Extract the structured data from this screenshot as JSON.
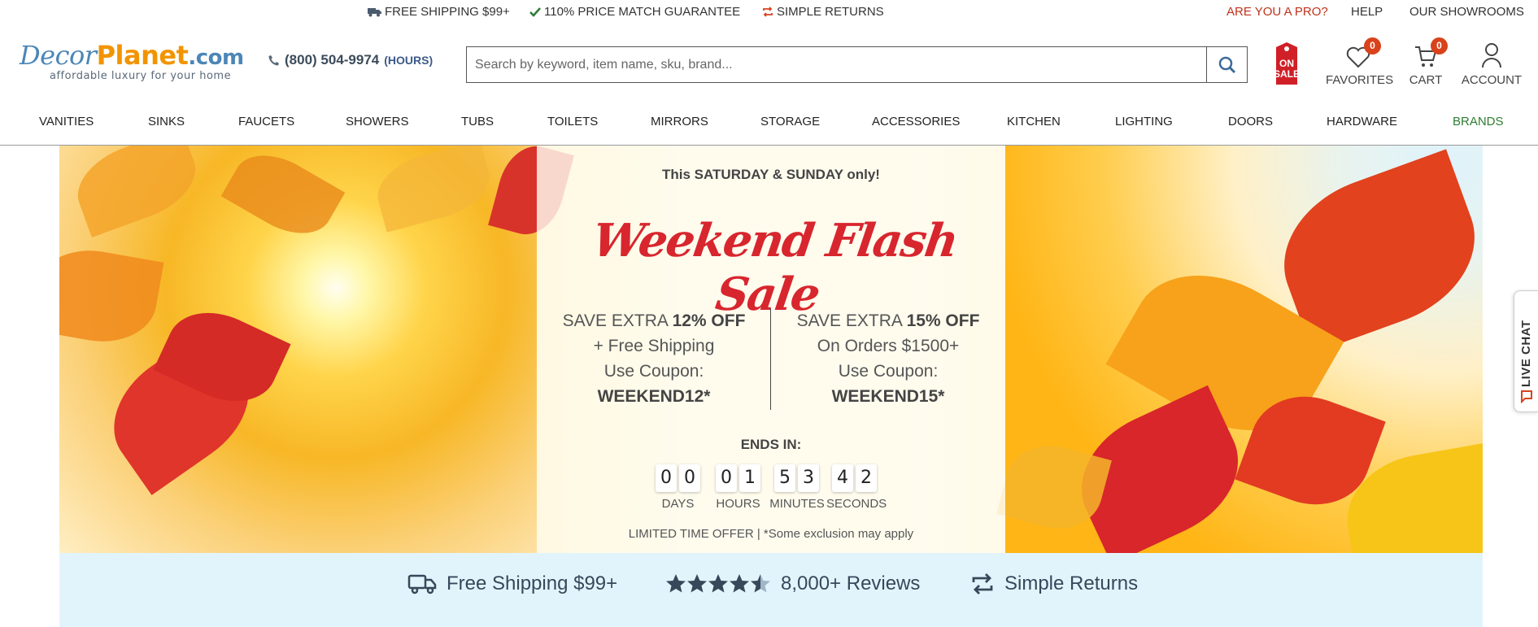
{
  "topbar": {
    "promos": [
      {
        "icon": "truck-icon",
        "label": "FREE SHIPPING $99+"
      },
      {
        "icon": "checkmark-icon",
        "label": "110% PRICE MATCH GUARANTEE"
      },
      {
        "icon": "returns-icon",
        "label": "SIMPLE RETURNS"
      }
    ],
    "links": {
      "pro": "ARE YOU A PRO?",
      "help": "HELP",
      "showrooms": "OUR SHOWROOMS"
    }
  },
  "logo": {
    "decor": "Decor",
    "planet": "Planet",
    "com": ".com",
    "tagline": "affordable luxury for your home"
  },
  "phone": {
    "number": "(800) 504-9974",
    "hours": "(HOURS)"
  },
  "search": {
    "placeholder": "Search by keyword, item name, sku, brand..."
  },
  "onsale": {
    "line1": "ON",
    "line2": "SALE"
  },
  "header_icons": {
    "favorites": {
      "label": "FAVORITES",
      "count": "0"
    },
    "cart": {
      "label": "CART",
      "count": "0"
    },
    "account": {
      "label": "ACCOUNT"
    }
  },
  "nav": [
    "VANITIES",
    "SINKS",
    "FAUCETS",
    "SHOWERS",
    "TUBS",
    "TOILETS",
    "MIRRORS",
    "STORAGE",
    "ACCESSORIES",
    "KITCHEN",
    "LIGHTING",
    "DOORS",
    "HARDWARE",
    "BRANDS"
  ],
  "banner": {
    "small": "This SATURDAY & SUNDAY only!",
    "title": "Weekend Flash Sale",
    "offer1": {
      "prefix": "SAVE EXTRA ",
      "pct": "12% OFF",
      "line2": "+ Free Shipping",
      "line3": "Use Coupon:",
      "code": "WEEKEND12*"
    },
    "offer2": {
      "prefix": "SAVE EXTRA ",
      "pct": "15% OFF",
      "line2": "On Orders $1500+",
      "line3": "Use Coupon:",
      "code": "WEEKEND15*"
    },
    "ends_label": "ENDS IN:",
    "countdown": {
      "days": [
        "0",
        "0"
      ],
      "hours": [
        "0",
        "1"
      ],
      "minutes": [
        "5",
        "3"
      ],
      "seconds": [
        "4",
        "2"
      ],
      "labels": {
        "days": "DAYS",
        "hours": "HOURS",
        "minutes": "MINUTES",
        "seconds": "SECONDS"
      }
    },
    "limited": "LIMITED TIME OFFER | *Some exclusion may apply"
  },
  "trust": {
    "shipping": "Free Shipping $99+",
    "reviews": "8,000+ Reviews",
    "rating_stars": 4.5,
    "returns": "Simple Returns"
  },
  "livechat": "LIVE CHAT",
  "colors": {
    "accent_red": "#d8431c",
    "logo_blue": "#4c86b7",
    "logo_orange": "#f29400",
    "sale_red": "#d8262e",
    "brands_green": "#2e7d32",
    "strip_bg": "#e2f4fb"
  }
}
